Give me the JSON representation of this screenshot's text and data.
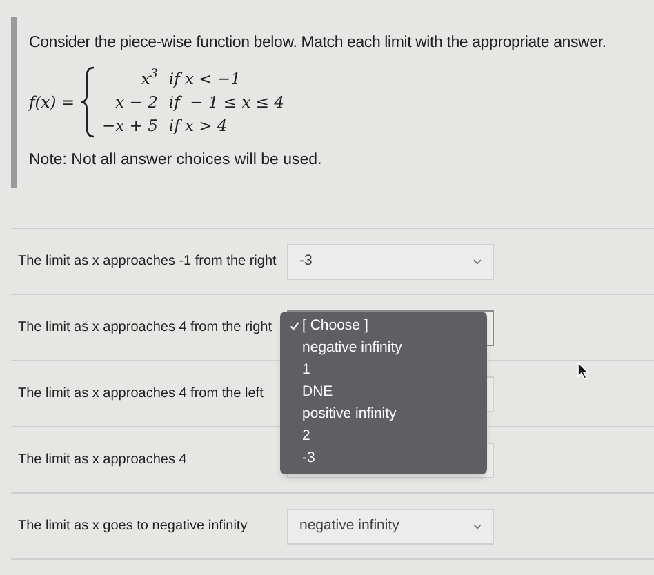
{
  "instructions": "Consider the piece-wise function below.  Match each limit with the appropriate answer.",
  "function": {
    "lhs": "f(x) =",
    "pieces": [
      {
        "expression": "x$^{3}$",
        "condition": "if x < −1"
      },
      {
        "expression": "x − 2",
        "condition": "if  − 1 ≤ x ≤ 4"
      },
      {
        "expression": "−x + 5",
        "condition": "if x > 4"
      }
    ]
  },
  "note": "Note: Not all answer choices will be used.",
  "questions": [
    {
      "label": "The limit as x approaches -1 from the right",
      "value": "-3",
      "expanded": false
    },
    {
      "label": "The limit as x approaches 4 from the right",
      "expanded": true,
      "options": [
        {
          "label": "[ Choose ]",
          "selected": true
        },
        {
          "label": "negative infinity",
          "selected": false
        },
        {
          "label": "1",
          "selected": false
        },
        {
          "label": "DNE",
          "selected": false
        },
        {
          "label": "positive infinity",
          "selected": false
        },
        {
          "label": "2",
          "selected": false
        },
        {
          "label": "-3",
          "selected": false
        }
      ]
    },
    {
      "label": "The limit as x approaches 4 from the left",
      "expanded": false
    },
    {
      "label": "The limit as x approaches 4",
      "expanded": false
    },
    {
      "label": "The limit as x goes to negative infinity",
      "value": "negative infinity",
      "expanded": false
    }
  ]
}
